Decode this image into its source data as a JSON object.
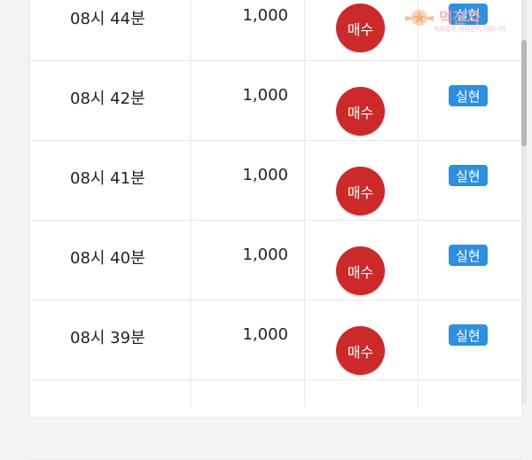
{
  "watermark": {
    "main": "먹잔자",
    "sub": "먹튀검증 먹튀잔치 커뮤니티"
  },
  "buy_color": "#cc2a2a",
  "badge_color": "#2e8fde",
  "rows": [
    {
      "time": "08시 44분",
      "amount": "1,000",
      "action": "매수",
      "status": "실현"
    },
    {
      "time": "08시 42분",
      "amount": "1,000",
      "action": "매수",
      "status": "실현"
    },
    {
      "time": "08시 41분",
      "amount": "1,000",
      "action": "매수",
      "status": "실현"
    },
    {
      "time": "08시 40분",
      "amount": "1,000",
      "action": "매수",
      "status": "실현"
    },
    {
      "time": "08시 39분",
      "amount": "1,000",
      "action": "매수",
      "status": "실현"
    }
  ]
}
